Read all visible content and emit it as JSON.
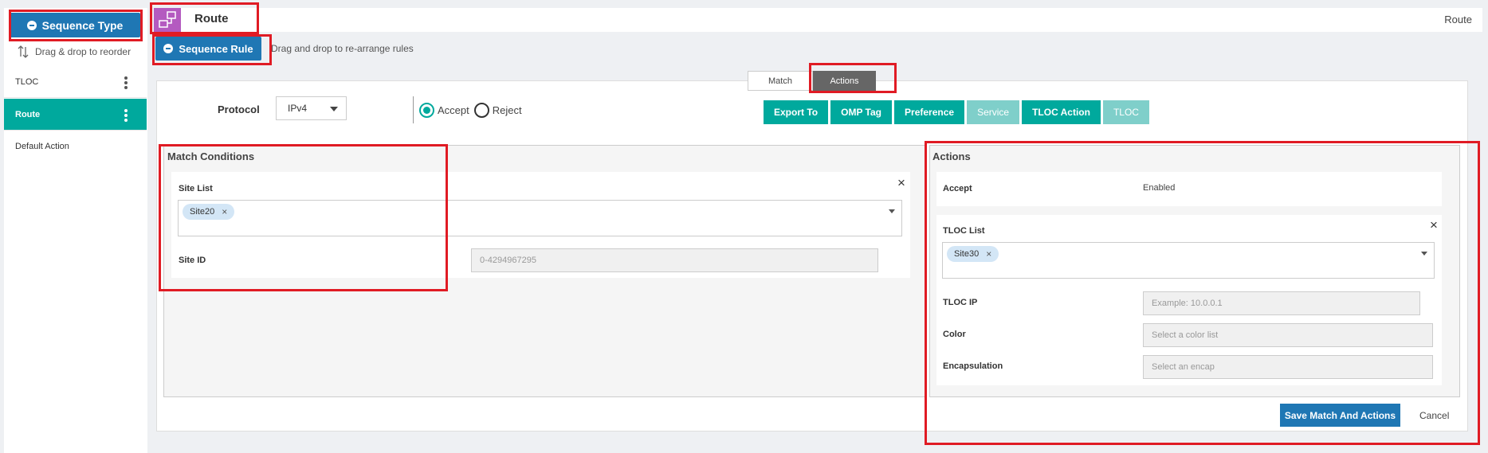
{
  "sidebar": {
    "sequence_type_label": "Sequence Type",
    "reorder_hint": "Drag & drop to reorder",
    "items": [
      {
        "label": "TLOC"
      },
      {
        "label": "Route"
      },
      {
        "label": "Default Action"
      }
    ]
  },
  "header": {
    "title": "Route",
    "right_label": "Route"
  },
  "sequence_rule": {
    "button_label": "Sequence Rule",
    "hint": "Drag and drop to re-arrange rules"
  },
  "tabs": [
    {
      "label": "Match",
      "active": false
    },
    {
      "label": "Actions",
      "active": true
    }
  ],
  "protocol": {
    "label": "Protocol",
    "value": "IPv4"
  },
  "accept_reject": {
    "accept_label": "Accept",
    "reject_label": "Reject",
    "selected": "Accept"
  },
  "action_buttons": [
    {
      "label": "Export To",
      "enabled": true
    },
    {
      "label": "OMP Tag",
      "enabled": true
    },
    {
      "label": "Preference",
      "enabled": true
    },
    {
      "label": "Service",
      "enabled": false
    },
    {
      "label": "TLOC Action",
      "enabled": true
    },
    {
      "label": "TLOC",
      "enabled": false
    }
  ],
  "match_conditions": {
    "title": "Match Conditions",
    "site_list_label": "Site List",
    "site_list_chip": "Site20",
    "site_id_label": "Site ID",
    "site_id_placeholder": "0-4294967295"
  },
  "actions": {
    "title": "Actions",
    "accept_label": "Accept",
    "accept_value": "Enabled",
    "tloc_list_label": "TLOC List",
    "tloc_list_chip": "Site30",
    "tloc_ip_label": "TLOC IP",
    "tloc_ip_placeholder": "Example: 10.0.0.1",
    "color_label": "Color",
    "color_placeholder": "Select a color list",
    "encap_label": "Encapsulation",
    "encap_placeholder": "Select an encap"
  },
  "footer": {
    "save_label": "Save Match And Actions",
    "cancel_label": "Cancel"
  },
  "colors": {
    "primary": "#1f77b4",
    "teal": "#00a99d",
    "highlight": "#e01b24",
    "route_icon": "#b45ac0"
  },
  "icons": [
    "minus-circle-icon",
    "reorder-arrows-icon",
    "kebab-menu-icon",
    "route-policy-icon",
    "close-icon",
    "chevron-down-icon"
  ]
}
